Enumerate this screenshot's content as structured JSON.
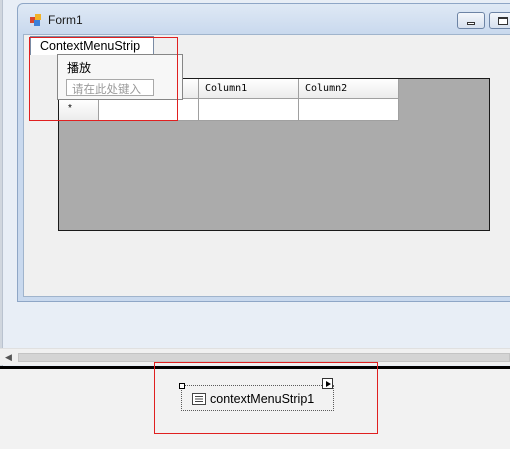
{
  "form": {
    "title": "Form1"
  },
  "context_menu_strip": {
    "tab_label": "ContextMenuStrip",
    "items": [
      "播放"
    ],
    "type_here_placeholder": "请在此处键入"
  },
  "grid": {
    "columns": [
      "Column1",
      "Column2"
    ],
    "new_row_marker": "*"
  },
  "component_tray": {
    "item_label": "contextMenuStrip1"
  },
  "colors": {
    "highlight_red": "#e02020",
    "grid_background": "#ababab"
  }
}
